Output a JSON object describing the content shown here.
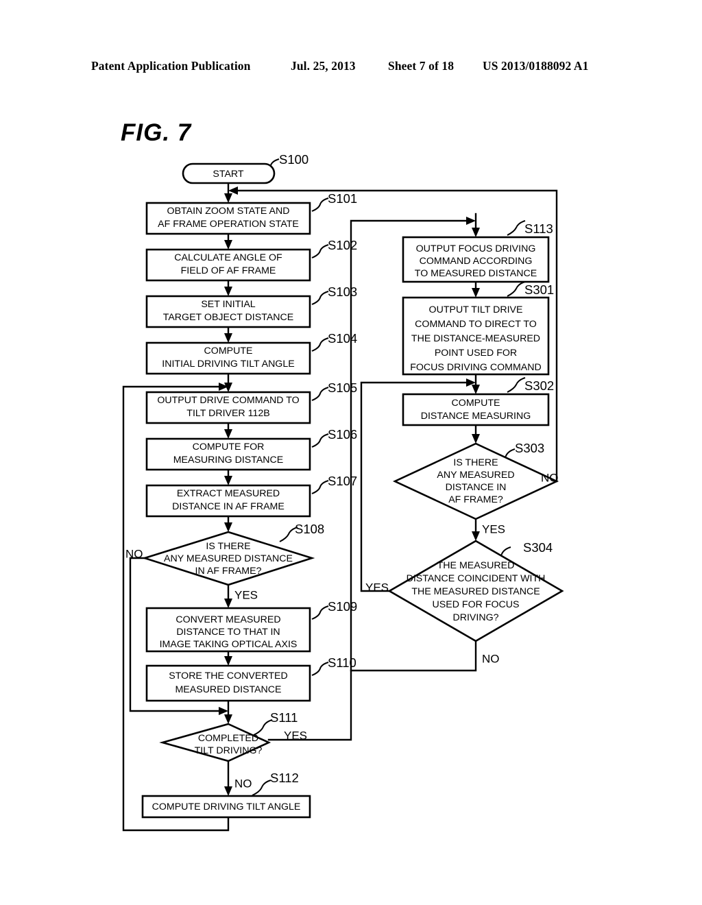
{
  "header": {
    "publication": "Patent Application Publication",
    "date": "Jul. 25, 2013",
    "sheet": "Sheet 7 of 18",
    "number": "US 2013/0188092 A1"
  },
  "figure": {
    "label": "FIG. 7"
  },
  "flowchart": {
    "start": {
      "id": "S100",
      "label": "START"
    },
    "nodes": [
      {
        "id": "S101",
        "type": "process",
        "lines": [
          "OBTAIN ZOOM STATE AND",
          "AF FRAME OPERATION STATE"
        ]
      },
      {
        "id": "S102",
        "type": "process",
        "lines": [
          "CALCULATE ANGLE OF",
          "FIELD OF AF FRAME"
        ]
      },
      {
        "id": "S103",
        "type": "process",
        "lines": [
          "SET INITIAL",
          "TARGET OBJECT DISTANCE"
        ]
      },
      {
        "id": "S104",
        "type": "process",
        "lines": [
          "COMPUTE",
          "INITIAL DRIVING TILT ANGLE"
        ]
      },
      {
        "id": "S105",
        "type": "process",
        "lines": [
          "OUTPUT DRIVE COMMAND TO",
          "TILT DRIVER 112B"
        ]
      },
      {
        "id": "S106",
        "type": "process",
        "lines": [
          "COMPUTE FOR",
          "MEASURING DISTANCE"
        ]
      },
      {
        "id": "S107",
        "type": "process",
        "lines": [
          "EXTRACT MEASURED",
          "DISTANCE IN AF FRAME"
        ]
      },
      {
        "id": "S108",
        "type": "decision",
        "lines": [
          "IS THERE",
          "ANY MEASURED DISTANCE",
          "IN AF FRAME?"
        ],
        "branch_yes": "YES",
        "branch_no": "NO"
      },
      {
        "id": "S109",
        "type": "process",
        "lines": [
          "CONVERT MEASURED",
          "DISTANCE TO THAT IN",
          "IMAGE TAKING OPTICAL AXIS"
        ]
      },
      {
        "id": "S110",
        "type": "process",
        "lines": [
          "STORE THE CONVERTED",
          "MEASURED DISTANCE"
        ]
      },
      {
        "id": "S111",
        "type": "decision",
        "lines": [
          "COMPLETED",
          "TILT DRIVING?"
        ],
        "branch_yes": "YES",
        "branch_no": "NO"
      },
      {
        "id": "S112",
        "type": "process",
        "lines": [
          "COMPUTE DRIVING TILT ANGLE"
        ]
      },
      {
        "id": "S113",
        "type": "process",
        "lines": [
          "OUTPUT FOCUS DRIVING",
          "COMMAND ACCORDING",
          "TO MEASURED DISTANCE"
        ]
      },
      {
        "id": "S301",
        "type": "process",
        "lines": [
          "OUTPUT TILT DRIVE",
          "COMMAND TO DIRECT TO",
          "THE DISTANCE-MEASURED",
          "POINT USED FOR",
          "FOCUS DRIVING COMMAND"
        ]
      },
      {
        "id": "S302",
        "type": "process",
        "lines": [
          "COMPUTE",
          "DISTANCE MEASURING"
        ]
      },
      {
        "id": "S303",
        "type": "decision",
        "lines": [
          "IS THERE",
          "ANY MEASURED",
          "DISTANCE IN",
          "AF FRAME?"
        ],
        "branch_yes": "YES",
        "branch_no": "NO"
      },
      {
        "id": "S304",
        "type": "decision",
        "lines": [
          "THE MEASURED",
          "DISTANCE COINCIDENT WITH",
          "THE MEASURED DISTANCE",
          "USED FOR FOCUS",
          "DRIVING?"
        ],
        "branch_yes": "YES",
        "branch_no": "NO"
      }
    ]
  }
}
